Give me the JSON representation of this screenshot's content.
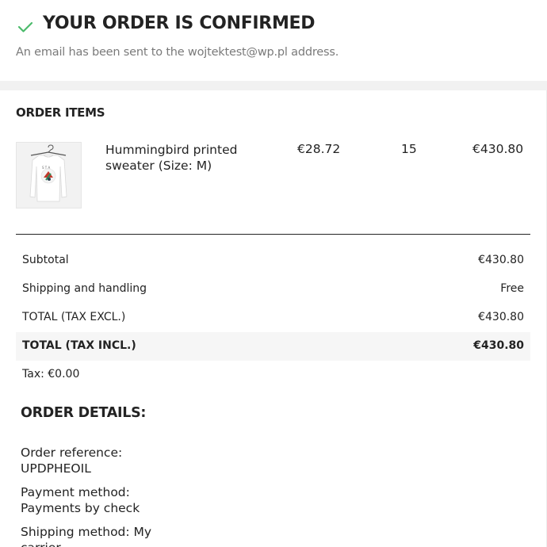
{
  "header": {
    "title": "YOUR ORDER IS CONFIRMED",
    "email_notice": "An email has been sent to the wojtektest@wp.pl address."
  },
  "order_items": {
    "heading": "ORDER ITEMS",
    "items": [
      {
        "name": "Hummingbird printed sweater (Size: M)",
        "unit_price": "€28.72",
        "quantity": "15",
        "total": "€430.80",
        "image": "white-long-sleeve-sweater-on-hanger"
      }
    ]
  },
  "summary": {
    "subtotal_label": "Subtotal",
    "subtotal_value": "€430.80",
    "shipping_label": "Shipping and handling",
    "shipping_value": "Free",
    "total_excl_label": "TOTAL (TAX EXCL.)",
    "total_excl_value": "€430.80",
    "total_incl_label": "TOTAL (TAX INCL.)",
    "total_incl_value": "€430.80",
    "tax_line": "Tax: €0.00"
  },
  "order_details": {
    "heading": "ORDER DETAILS:",
    "reference": "Order reference: UPDPHEOIL",
    "payment": "Payment method: Payments by check",
    "shipping": "Shipping method: My carrier"
  },
  "colors": {
    "check_green": "#4cbb6c",
    "text_dark": "#232323",
    "text_muted": "#7a7a7a",
    "band_gray": "#f1f1f1"
  }
}
